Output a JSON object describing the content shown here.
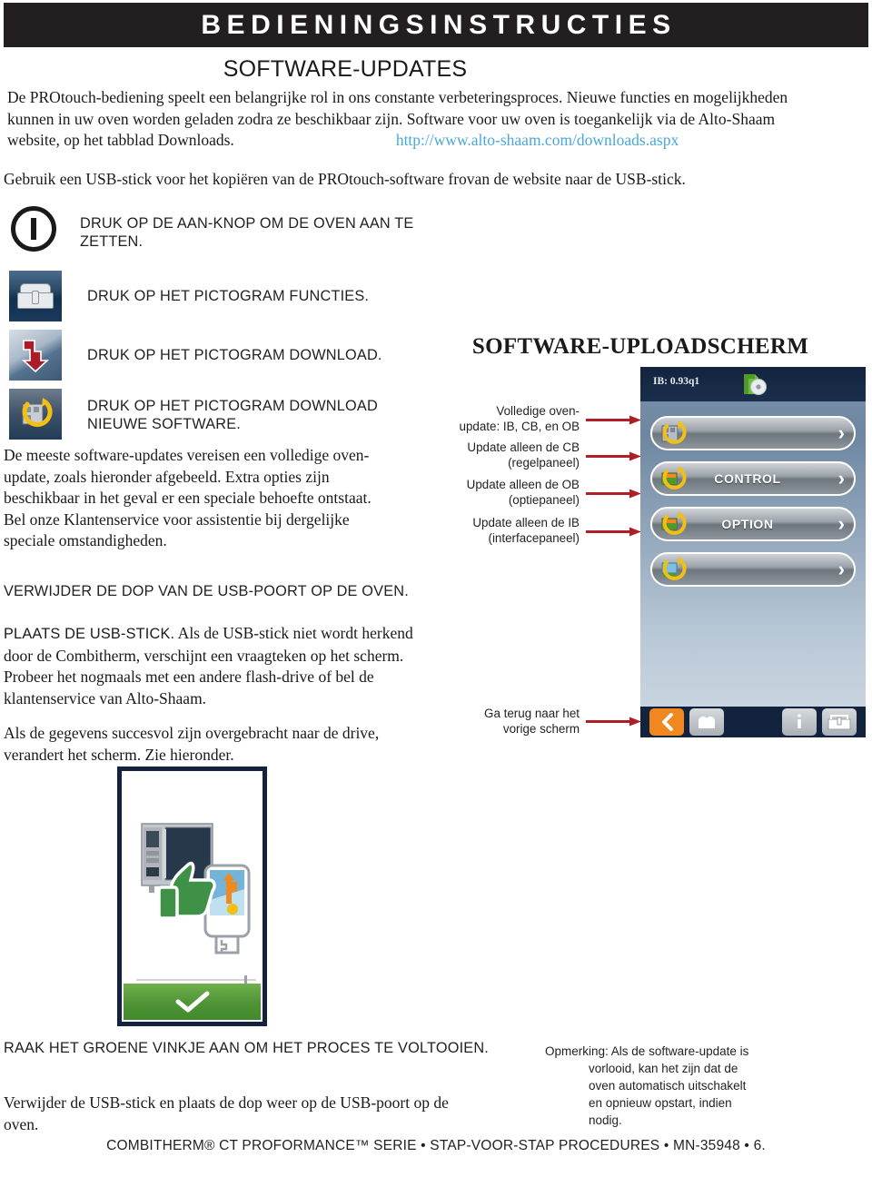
{
  "header": {
    "title": "BEDIENINGSINSTRUCTIES"
  },
  "section": {
    "title": "SOFTWARE-UPDATES"
  },
  "intro": {
    "line1": "De PROtouch-bediening speelt een belangrijke rol in ons constante verbeteringsproces. Nieuwe functies en mogelijkheden",
    "line2": "kunnen in uw oven worden geladen zodra ze beschikbaar zijn. Software voor uw oven is toegankelijk via de Alto-Shaam",
    "line3_a": "website, op het tabblad Downloads.",
    "link": "http://www.alto-shaam.com/downloads.aspx",
    "paragraph2": "Gebruik een USB-stick voor het kopiëren van de PROtouch-software frovan de website naar de USB-stick."
  },
  "steps": [
    {
      "icon": "power-button-icon",
      "label": "DRUK OP DE AAN-KNOP OM DE OVEN AAN TE ZETTEN."
    },
    {
      "icon": "functions-toolbox-icon",
      "label": "DRUK OP HET PICTOGRAM FUNCTIES."
    },
    {
      "icon": "download-arrow-icon",
      "label": "DRUK OP HET PICTOGRAM DOWNLOAD."
    },
    {
      "icon": "download-new-software-icon",
      "label": "DRUK OP HET PICTOGRAM DOWNLOAD NIEUWE SOFTWARE."
    }
  ],
  "left_column": {
    "paragraph_updates": "De meeste software-updates vereisen een volledige oven-update, zoals hieronder afgebeeld. Extra opties zijn beschikbaar in het geval er een speciale behoefte ontstaat. Bel onze Klantenservice voor assistentie bij dergelijke speciale omstandigheden.",
    "remove_cap_caps": "VERWIJDER DE DOP VAN DE USB-POORT OP DE OVEN.",
    "insert_usb_lead": "PLAATS DE USB-STICK.",
    "insert_usb_rest": " Als de USB-stick niet wordt herkend door de Combitherm, verschijnt een vraagteken op het scherm. Probeer het nogmaals met een andere flash-drive of bel de klantenservice van Alto-Shaam.",
    "transfer_ok": "Als de gegevens succesvol zijn overgebracht naar de drive, verandert het scherm. Zie hieronder.",
    "finish_caps": "RAAK HET GROENE VINKJE AAN OM HET PROCES TE VOLTOOIEN.",
    "finish_body": "Verwijder de USB-stick en plaats de dop weer op de USB-poort op de oven."
  },
  "upload_screen": {
    "title": "SOFTWARE-UPLOADSCHERM",
    "status_text": "IB: 0.93q1",
    "callouts": [
      {
        "line1": "Volledige oven-",
        "line2": "update: IB, CB, en OB"
      },
      {
        "line1": "Update alleen de CB",
        "line2": "(regelpaneel)"
      },
      {
        "line1": "Update alleen de OB",
        "line2": "(optiepaneel)"
      },
      {
        "line1": "Update alleen de IB",
        "line2": "(interfacepaneel)"
      }
    ],
    "back_callout": {
      "line1": "Ga terug naar het",
      "line2": "vorige scherm"
    },
    "buttons": [
      {
        "label": "",
        "icon": "full-oven-update-icon"
      },
      {
        "label": "CONTROL",
        "icon": "control-board-icon"
      },
      {
        "label": "OPTION",
        "icon": "option-board-icon"
      },
      {
        "label": "",
        "icon": "interface-board-icon"
      }
    ],
    "nav": [
      {
        "name": "back",
        "icon": "chevron-left-icon"
      },
      {
        "name": "home",
        "icon": "home-icon"
      },
      {
        "name": "info",
        "icon": "info-icon"
      },
      {
        "name": "functions",
        "icon": "toolbox-icon"
      }
    ],
    "accent_orange": "#f0881f",
    "arrow_color": "#b01e28",
    "topbar_color": "#13233d"
  },
  "note": {
    "label": "Opmerking:",
    "line1": "Als de software-update is",
    "line2": "vorlooid, kan het zijn dat de",
    "line3": "oven automatisch uitschakelt",
    "line4": "en opnieuw opstart, indien",
    "line5": "nodig."
  },
  "footer": {
    "text": "COMBITHERM® CT PROFORMANCE™ SERIE • STAP-VOOR-STAP PROCEDURES • MN-35948 • 6."
  }
}
